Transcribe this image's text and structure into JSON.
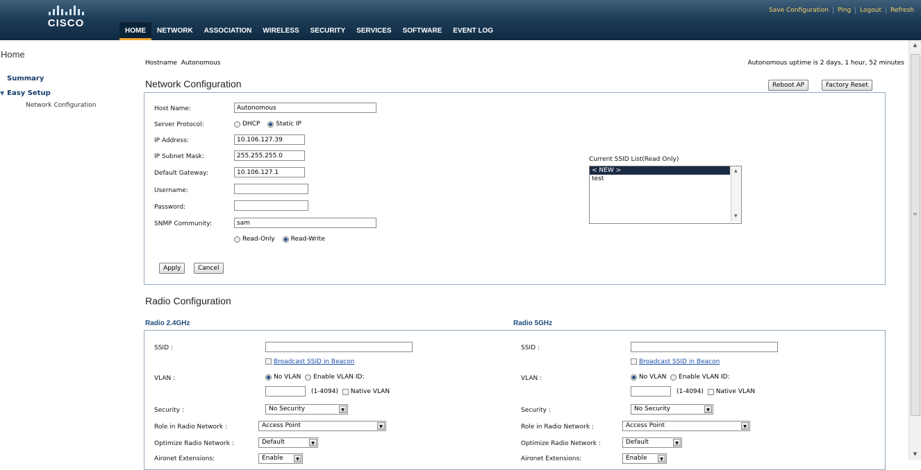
{
  "header": {
    "logo_text": "cisco",
    "top_links": [
      "Save Configuration",
      "Ping",
      "Logout",
      "Refresh"
    ],
    "nav": [
      "HOME",
      "NETWORK",
      "ASSOCIATION",
      "WIRELESS",
      "SECURITY",
      "SERVICES",
      "SOFTWARE",
      "EVENT LOG"
    ],
    "active_nav": "HOME"
  },
  "sidebar": {
    "title": "Home",
    "summary": "Summary",
    "easy_setup": "Easy Setup",
    "network_configuration": "Network Configuration"
  },
  "status": {
    "hostname_label": "Hostname",
    "hostname_value": "Autonomous",
    "uptime": "Autonomous uptime is 2 days, 1 hour, 52 minutes"
  },
  "network_config": {
    "title": "Network Configuration",
    "reboot_button": "Reboot AP",
    "factory_reset_button": "Factory Reset",
    "host_name_label": "Host Name:",
    "host_name_value": "Autonomous",
    "server_protocol_label": "Server Protocol:",
    "server_protocol_options": [
      "DHCP",
      "Static IP"
    ],
    "server_protocol_selected": "Static IP",
    "ip_address_label": "IP Address:",
    "ip_address_value": "10.106.127.39",
    "subnet_label": "IP Subnet Mask:",
    "subnet_value": "255.255.255.0",
    "gateway_label": "Default Gateway:",
    "gateway_value": "10.106.127.1",
    "username_label": "Username:",
    "username_value": "",
    "password_label": "Password:",
    "password_value": "",
    "snmp_label": "SNMP Community:",
    "snmp_value": "sam",
    "snmp_access_options": [
      "Read-Only",
      "Read-Write"
    ],
    "snmp_access_selected": "Read-Write",
    "apply_button": "Apply",
    "cancel_button": "Cancel",
    "ssid_list_label": "Current SSID List(Read Only)",
    "ssid_list": [
      "< NEW >",
      "test"
    ],
    "ssid_selected": "< NEW >"
  },
  "radio_config": {
    "title": "Radio Configuration",
    "radios": [
      {
        "heading": "Radio 2.4GHz",
        "ssid_label": "SSID :",
        "ssid_value": "",
        "broadcast_label": "Broadcast SSID in Beacon",
        "vlan_label": "VLAN :",
        "vlan_options": [
          "No VLAN",
          "Enable VLAN ID:"
        ],
        "vlan_selected": "No VLAN",
        "vlan_range": "(1-4094)",
        "native_vlan_label": "Native VLAN",
        "security_label": "Security :",
        "security_value": "No Security",
        "role_label": "Role in Radio Network :",
        "role_value": "Access Point",
        "optimize_label": "Optimize Radio Network :",
        "optimize_value": "Default",
        "aironet_label": "Aironet Extensions:",
        "aironet_value": "Enable"
      },
      {
        "heading": "Radio 5GHz",
        "ssid_label": "SSID :",
        "ssid_value": "",
        "broadcast_label": "Broadcast SSID in Beacon",
        "vlan_label": "VLAN :",
        "vlan_options": [
          "No VLAN",
          "Enable VLAN ID:"
        ],
        "vlan_selected": "No VLAN",
        "vlan_range": "(1-4094)",
        "native_vlan_label": "Native VLAN",
        "security_label": "Security :",
        "security_value": "No Security",
        "role_label": "Role in Radio Network :",
        "role_value": "Access Point",
        "optimize_label": "Optimize Radio Network :",
        "optimize_value": "Default",
        "aironet_label": "Aironet Extensions:",
        "aironet_value": "Enable"
      }
    ]
  }
}
